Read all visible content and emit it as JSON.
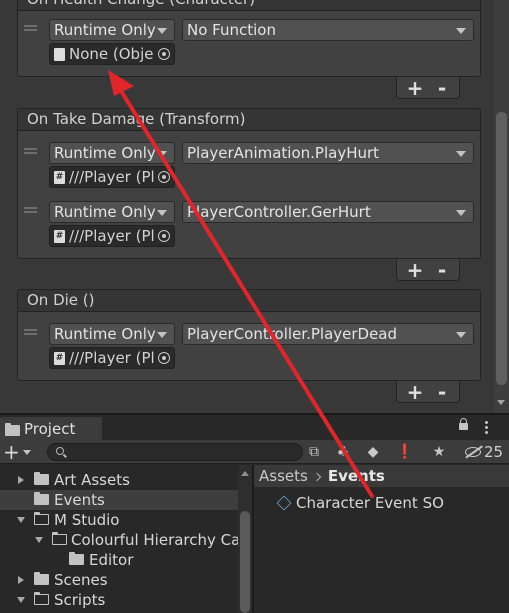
{
  "inspector": {
    "events": [
      {
        "header": "On Health Change (Character)",
        "listeners": [
          {
            "mode": "Runtime Only",
            "function": "No Function",
            "object": "None (Object)",
            "object_icon": "file-icon"
          }
        ],
        "add_label": "+",
        "remove_label": "-"
      },
      {
        "header": "On Take Damage (Transform)",
        "listeners": [
          {
            "mode": "Runtime Only",
            "function": "PlayerAnimation.PlayHurt",
            "object": "///Player (Player)",
            "object_icon": "script-icon"
          },
          {
            "mode": "Runtime Only",
            "function": "PlayerController.GerHurt",
            "object": "///Player (Player)",
            "object_icon": "script-icon"
          }
        ],
        "add_label": "+",
        "remove_label": "-"
      },
      {
        "header": "On Die ()",
        "listeners": [
          {
            "mode": "Runtime Only",
            "function": "PlayerController.PlayerDead",
            "object": "///Player (Player)",
            "object_icon": "script-icon"
          }
        ],
        "add_label": "+",
        "remove_label": "-"
      }
    ]
  },
  "project": {
    "tab_label": "Project",
    "toolbar": {
      "add_label": "+",
      "search_placeholder": "",
      "hidden_count": "25"
    },
    "tree": [
      {
        "label": "Art Assets",
        "expand": "collapsed"
      },
      {
        "label": "Events",
        "expand": "none",
        "selected": true
      },
      {
        "label": "M Studio",
        "expand": "expanded"
      },
      {
        "label": "Colourful Hierarchy Category",
        "expand": "expanded"
      },
      {
        "label": "Editor",
        "expand": "none"
      },
      {
        "label": "Scenes",
        "expand": "collapsed"
      },
      {
        "label": "Scripts",
        "expand": "expanded"
      }
    ],
    "breadcrumb": {
      "root": "Assets",
      "current": "Events"
    },
    "assets": [
      {
        "label": "Character Event SO",
        "icon": "scriptable-object-icon"
      }
    ]
  },
  "colors": {
    "annotation_arrow": "#e0262b",
    "panel_bg": "#383838",
    "field_bg": "#2a2a2a"
  }
}
